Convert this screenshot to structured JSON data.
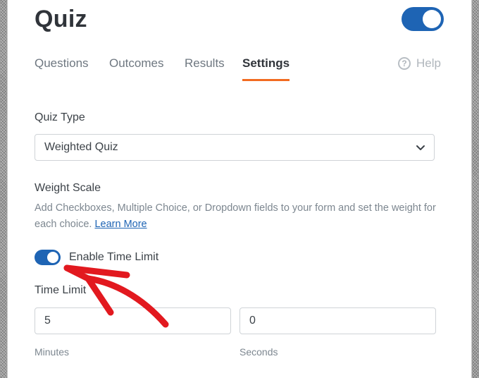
{
  "header": {
    "title": "Quiz"
  },
  "tabs": [
    {
      "label": "Questions"
    },
    {
      "label": "Outcomes"
    },
    {
      "label": "Results"
    },
    {
      "label": "Settings"
    }
  ],
  "help": {
    "label": "Help",
    "glyph": "?"
  },
  "quiz_type": {
    "label": "Quiz Type",
    "value": "Weighted Quiz"
  },
  "weight_scale": {
    "label": "Weight Scale",
    "description": "Add Checkboxes, Multiple Choice, or Dropdown fields to your form and set the weight for each choice.",
    "link": "Learn More"
  },
  "time_limit_toggle": {
    "label": "Enable Time Limit",
    "enabled": true
  },
  "time_limit": {
    "label": "Time Limit",
    "minutes": {
      "value": "5",
      "label": "Minutes"
    },
    "seconds": {
      "value": "0",
      "label": "Seconds"
    }
  },
  "colors": {
    "accent": "#1e64b4",
    "tab_underline": "#f26b21",
    "arrow": "#e2191f"
  }
}
